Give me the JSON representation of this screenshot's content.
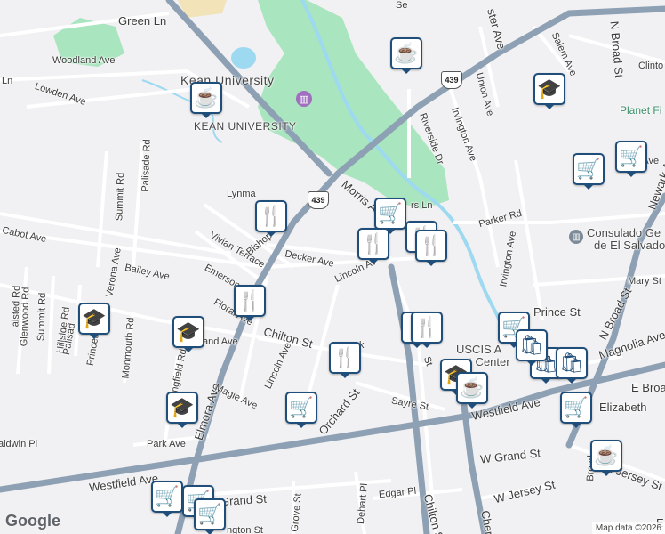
{
  "streets": [
    {
      "id": "green-ln",
      "label": "Green Ln"
    },
    {
      "id": "woodland-ave",
      "label": "Woodland Ave"
    },
    {
      "id": "lowden-ave",
      "label": "Lowden Ave"
    },
    {
      "id": "ln-left",
      "label": "Ln"
    },
    {
      "id": "summit-rd",
      "label": "Summit Rd"
    },
    {
      "id": "palisade-rd",
      "label": "Palisade Rd"
    },
    {
      "id": "cabot-ave",
      "label": "Cabot Ave"
    },
    {
      "id": "verona-ave",
      "label": "Verona Ave"
    },
    {
      "id": "bailey-ave",
      "label": "Bailey Ave"
    },
    {
      "id": "halsted-rd",
      "label": "alsted Rd"
    },
    {
      "id": "glenwood-rd",
      "label": "Glenwood Rd"
    },
    {
      "id": "summit-rd-2",
      "label": "Summit Rd"
    },
    {
      "id": "hillside-rd",
      "label": "Hillside Rd"
    },
    {
      "id": "palisade-2",
      "label": "Palisad"
    },
    {
      "id": "princeton",
      "label": "Princeto"
    },
    {
      "id": "monmouth-rd",
      "label": "Monmouth Rd"
    },
    {
      "id": "springfield-rd",
      "label": "Springfield Rd"
    },
    {
      "id": "park-ave",
      "label": "Park Ave"
    },
    {
      "id": "baldwin-pl",
      "label": "aldwin Pl"
    },
    {
      "id": "westfield-ave",
      "label": "Westfield Ave"
    },
    {
      "id": "westfield-ave-2",
      "label": "Westfield Ave"
    },
    {
      "id": "elmora-ave",
      "label": "Elmora Ave"
    },
    {
      "id": "magie-ave",
      "label": "Magie Ave"
    },
    {
      "id": "and-ave",
      "label": "and Ave"
    },
    {
      "id": "floral-ave",
      "label": "Floral Ave"
    },
    {
      "id": "emerson",
      "label": "Emerson"
    },
    {
      "id": "vivian-terrace",
      "label": "Vivian Terrace"
    },
    {
      "id": "bishop",
      "label": "Bishop"
    },
    {
      "id": "lynma",
      "label": "Lynma"
    },
    {
      "id": "decker-ave",
      "label": "Decker Ave"
    },
    {
      "id": "lincoln-ave",
      "label": "Lincoln Ave"
    },
    {
      "id": "lincoln-av",
      "label": "Lincoln Av"
    },
    {
      "id": "chilton-st",
      "label": "Chilton St"
    },
    {
      "id": "orchard-st",
      "label": "Orchard St"
    },
    {
      "id": "sayre-st",
      "label": "Sayre St"
    },
    {
      "id": "morris-av",
      "label": "Morris Av"
    },
    {
      "id": "rs-ln",
      "label": "rs Ln"
    },
    {
      "id": "parker-rd",
      "label": "Parker Rd"
    },
    {
      "id": "riverside-dr",
      "label": "Riverside Dr"
    },
    {
      "id": "irvington-ave",
      "label": "Irvington Ave"
    },
    {
      "id": "irvington-ave-2",
      "label": "Irvington Ave"
    },
    {
      "id": "union-ave",
      "label": "Union Ave"
    },
    {
      "id": "ster-ave",
      "label": "ster Ave"
    },
    {
      "id": "salem-ave",
      "label": "Salem Ave"
    },
    {
      "id": "n-broad-st",
      "label": "N Broad St"
    },
    {
      "id": "n-broad-st-2",
      "label": "N Broad St"
    },
    {
      "id": "clinto",
      "label": "Clinto"
    },
    {
      "id": "newark-ave",
      "label": "Newark Ave"
    },
    {
      "id": "mary-st",
      "label": "Mary St"
    },
    {
      "id": "prince-st",
      "label": "Prince St"
    },
    {
      "id": "magnolia-ave",
      "label": "Magnolia Ave"
    },
    {
      "id": "e-broa",
      "label": "E Broa"
    },
    {
      "id": "elizabeth",
      "label": "Elizabeth"
    },
    {
      "id": "w-grand-st",
      "label": "W Grand St"
    },
    {
      "id": "w-grand-st-2",
      "label": "W Grand St"
    },
    {
      "id": "w-jersey-st",
      "label": "W Jersey St"
    },
    {
      "id": "e-jersey-st",
      "label": "E Jersey St"
    },
    {
      "id": "broad",
      "label": "Broad"
    },
    {
      "id": "edgar-pl",
      "label": "Edgar Pl"
    },
    {
      "id": "dehart-pl",
      "label": "Dehart Pl"
    },
    {
      "id": "grove-st",
      "label": "Grove St"
    },
    {
      "id": "chilton-st-2",
      "label": "Chilton St"
    },
    {
      "id": "cher",
      "label": "Cher"
    },
    {
      "id": "st-ll",
      "label": "St"
    },
    {
      "id": "ngton-st",
      "label": "ngton St"
    },
    {
      "id": "k",
      "label": "k"
    },
    {
      "id": "w-ave",
      "label": "w Ave"
    },
    {
      "id": "se",
      "label": "Se"
    },
    {
      "id": "e-right",
      "label": "E"
    }
  ],
  "places": {
    "kean_university_top": "Kean University",
    "kean_university_bottom": "KEAN UNIVERSITY",
    "planet_fi": "Planet Fi",
    "consulado_line1": "Consulado Ge",
    "consulado_line2": "de El Salvador",
    "uscis_line1": "USCIS A",
    "uscis_line2": "rt Center"
  },
  "route_shields": [
    {
      "id": "route-439-top",
      "label": "439"
    },
    {
      "id": "route-439-mid",
      "label": "439"
    }
  ],
  "pins": [
    {
      "id": "cafe-kean",
      "icon": "coffee-cup-icon",
      "glyph": "☕"
    },
    {
      "id": "cafe-north",
      "icon": "coffee-cup-icon",
      "glyph": "☕"
    },
    {
      "id": "school-ne",
      "icon": "graduation-cap-icon",
      "glyph": "🎓"
    },
    {
      "id": "cart-ne1",
      "icon": "shopping-cart-icon",
      "glyph": "🛒"
    },
    {
      "id": "cart-ne2",
      "icon": "shopping-cart-icon",
      "glyph": "🛒"
    },
    {
      "id": "restaurant-bishop",
      "icon": "fork-knife-icon",
      "glyph": "🍴"
    },
    {
      "id": "cart-morris",
      "icon": "shopping-cart-icon",
      "glyph": "🛒"
    },
    {
      "id": "restaurant-lincoln",
      "icon": "fork-knife-icon",
      "glyph": "🍴"
    },
    {
      "id": "restaurant-decker1",
      "icon": "fork-knife-icon",
      "glyph": "🍴"
    },
    {
      "id": "restaurant-decker2",
      "icon": "fork-knife-icon",
      "glyph": "🍴"
    },
    {
      "id": "restaurant-floral",
      "icon": "fork-knife-icon",
      "glyph": "🍴"
    },
    {
      "id": "school-west",
      "icon": "graduation-cap-icon",
      "glyph": "🎓"
    },
    {
      "id": "school-mid",
      "icon": "graduation-cap-icon",
      "glyph": "🎓"
    },
    {
      "id": "school-sw",
      "icon": "graduation-cap-icon",
      "glyph": "🎓"
    },
    {
      "id": "restaurant-orchard",
      "icon": "fork-knife-icon",
      "glyph": "🍴"
    },
    {
      "id": "cart-orchard",
      "icon": "shopping-cart-icon",
      "glyph": "🛒"
    },
    {
      "id": "restaurant-chilton1",
      "icon": "fork-knife-icon",
      "glyph": "🍴"
    },
    {
      "id": "restaurant-chilton2",
      "icon": "fork-knife-icon",
      "glyph": "🍴"
    },
    {
      "id": "school-uscis",
      "icon": "graduation-cap-icon",
      "glyph": "🎓"
    },
    {
      "id": "cafe-uscis",
      "icon": "coffee-cup-icon",
      "glyph": "☕"
    },
    {
      "id": "store-prince",
      "icon": "shopping-cart-icon",
      "glyph": "🛒"
    },
    {
      "id": "bag-1",
      "icon": "shopping-bag-icon",
      "glyph": "🛍"
    },
    {
      "id": "bag-2",
      "icon": "shopping-bag-icon",
      "glyph": "🛍"
    },
    {
      "id": "bag-3",
      "icon": "shopping-bag-icon",
      "glyph": "🛍"
    },
    {
      "id": "cart-elizabeth",
      "icon": "shopping-cart-icon",
      "glyph": "🛒"
    },
    {
      "id": "cafe-broad",
      "icon": "coffee-cup-icon",
      "glyph": "☕"
    },
    {
      "id": "cart-sw1",
      "icon": "shopping-cart-icon",
      "glyph": "🛒"
    },
    {
      "id": "cart-sw2",
      "icon": "shopping-cart-icon",
      "glyph": "🛒"
    },
    {
      "id": "cart-sw3",
      "icon": "shopping-cart-icon",
      "glyph": "🛒"
    }
  ],
  "google_logo": "Google",
  "attribution": "Map data ©2026",
  "colors": {
    "background": "#f1f0f2",
    "park": "#a9e5bf",
    "water": "#9dd9f0",
    "major_road": "#8ea0b4",
    "pin_border": "#1f4e7a"
  }
}
